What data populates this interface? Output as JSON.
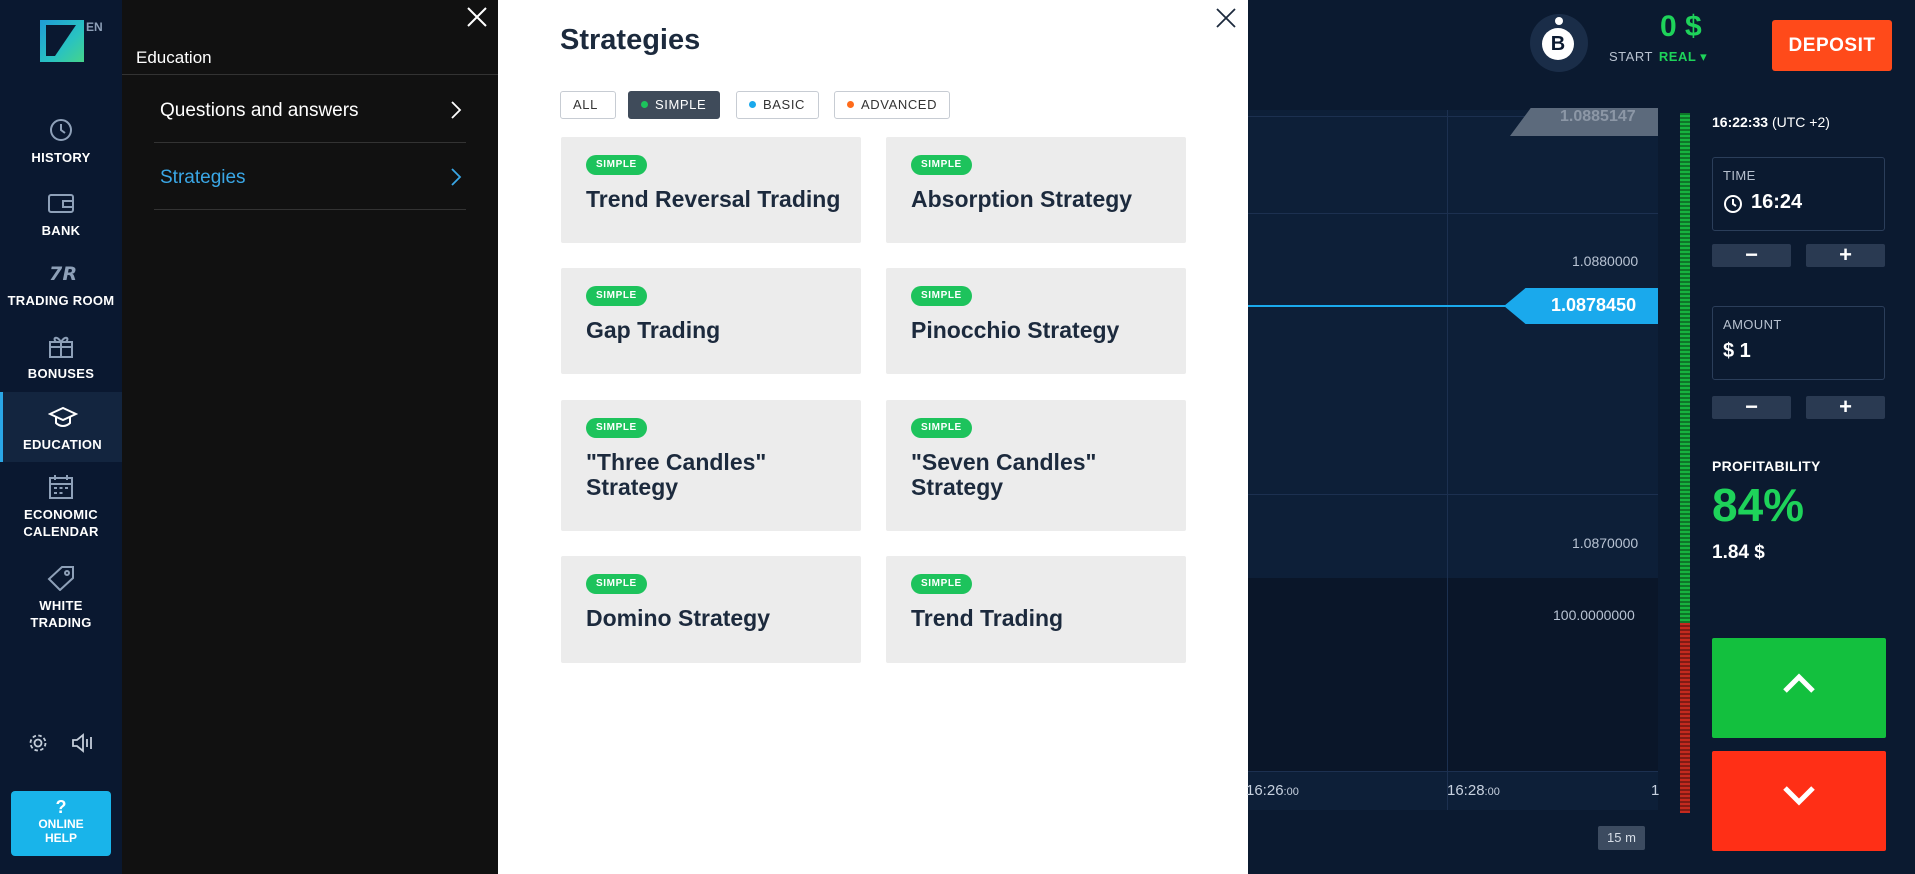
{
  "nav": {
    "lang": "EN",
    "items": [
      {
        "label": "HISTORY",
        "icon": "history-icon"
      },
      {
        "label": "BANK",
        "icon": "wallet-icon"
      },
      {
        "label": "TRADING ROOM",
        "icon": "trading-room-icon"
      },
      {
        "label": "BONUSES",
        "icon": "gift-icon"
      },
      {
        "label": "EDUCATION",
        "icon": "graduation-cap-icon"
      },
      {
        "label": "ECONOMIC\nCALENDAR",
        "label_line1": "ECONOMIC",
        "label_line2": "CALENDAR",
        "icon": "calendar-icon"
      },
      {
        "label": "WHITE\nTRADING",
        "label_line1": "WHITE",
        "label_line2": "TRADING",
        "icon": "tag-icon"
      }
    ],
    "help": {
      "q": "?",
      "line1": "ONLINE",
      "line2": "HELP"
    }
  },
  "education": {
    "title": "Education",
    "items": [
      {
        "label": "Questions and answers"
      },
      {
        "label": "Strategies"
      }
    ]
  },
  "strategies": {
    "title": "Strategies",
    "filters": [
      {
        "label": "ALL"
      },
      {
        "label": "SIMPLE",
        "dot": "#1dc35c"
      },
      {
        "label": "BASIC",
        "dot": "#1aa9ec"
      },
      {
        "label": "ADVANCED",
        "dot": "#ff6b1a"
      }
    ],
    "cards": [
      {
        "badge": "SIMPLE",
        "title": "Trend Reversal Trading"
      },
      {
        "badge": "SIMPLE",
        "title": "Absorption Strategy"
      },
      {
        "badge": "SIMPLE",
        "title": "Gap Trading"
      },
      {
        "badge": "SIMPLE",
        "title": "Pinocchio Strategy"
      },
      {
        "badge": "SIMPLE",
        "title": "\"Three Candles\" Strategy"
      },
      {
        "badge": "SIMPLE",
        "title": "\"Seven Candles\" Strategy"
      },
      {
        "badge": "SIMPLE",
        "title": "Domino Strategy"
      },
      {
        "badge": "SIMPLE",
        "title": "Trend Trading"
      }
    ]
  },
  "chart": {
    "price_top": "1.0885147",
    "price_current": "1.0878450",
    "price_levels": [
      "1.0880000",
      "1.0870000",
      "100.0000000"
    ],
    "times": [
      {
        "hm": "16:26",
        "sec": ":00"
      },
      {
        "hm": "16:28",
        "sec": ":00"
      }
    ],
    "time_edge": "1",
    "zoom": "15 m"
  },
  "account": {
    "avatar": "B",
    "balance": "0 $",
    "start": "START",
    "real": "REAL ▾",
    "deposit": "DEPOSIT"
  },
  "trade": {
    "clock_time": "16:22:33",
    "clock_tz": "(UTC +2)",
    "time_label": "TIME",
    "time_value": "16:24",
    "amount_label": "AMOUNT",
    "amount_value": "$ 1",
    "minus": "−",
    "plus": "+",
    "profit_label": "PROFITABILITY",
    "profit_value": "84%",
    "profit_amount": "1.84 $"
  }
}
